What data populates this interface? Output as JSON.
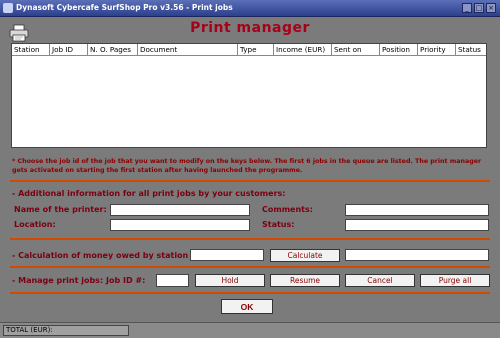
{
  "window": {
    "title": "Dynasoft Cybercafe SurfShop Pro v3.56 - Print jobs"
  },
  "page": {
    "title": "Print manager"
  },
  "table": {
    "columns": [
      "Station",
      "Job ID",
      "N. O. Pages",
      "Document",
      "Type",
      "Income (EUR)",
      "Sent on",
      "Position",
      "Priority",
      "Status"
    ]
  },
  "instructions": "* Choose the job id of the job that you want to modify on the keys below. The first 6 jobs in the queue are listed. The print manager gets activated on starting the first station after having launched the programme.",
  "additional_info": {
    "heading": "- Additional information for all print jobs by your customers:",
    "printer_name_label": "Name of the printer:",
    "location_label": "Location:",
    "comments_label": "Comments:",
    "status_label": "Status:"
  },
  "calculation": {
    "label": "- Calculation of money owed by station #:",
    "button": "Calculate"
  },
  "manage": {
    "label": "- Manage print jobs:",
    "job_id_label": "Job ID #:",
    "hold": "Hold",
    "resume": "Resume",
    "cancel": "Cancel",
    "purge": "Purge all"
  },
  "ok_button": "OK",
  "statusbar": {
    "total": "TOTAL (EUR):"
  }
}
